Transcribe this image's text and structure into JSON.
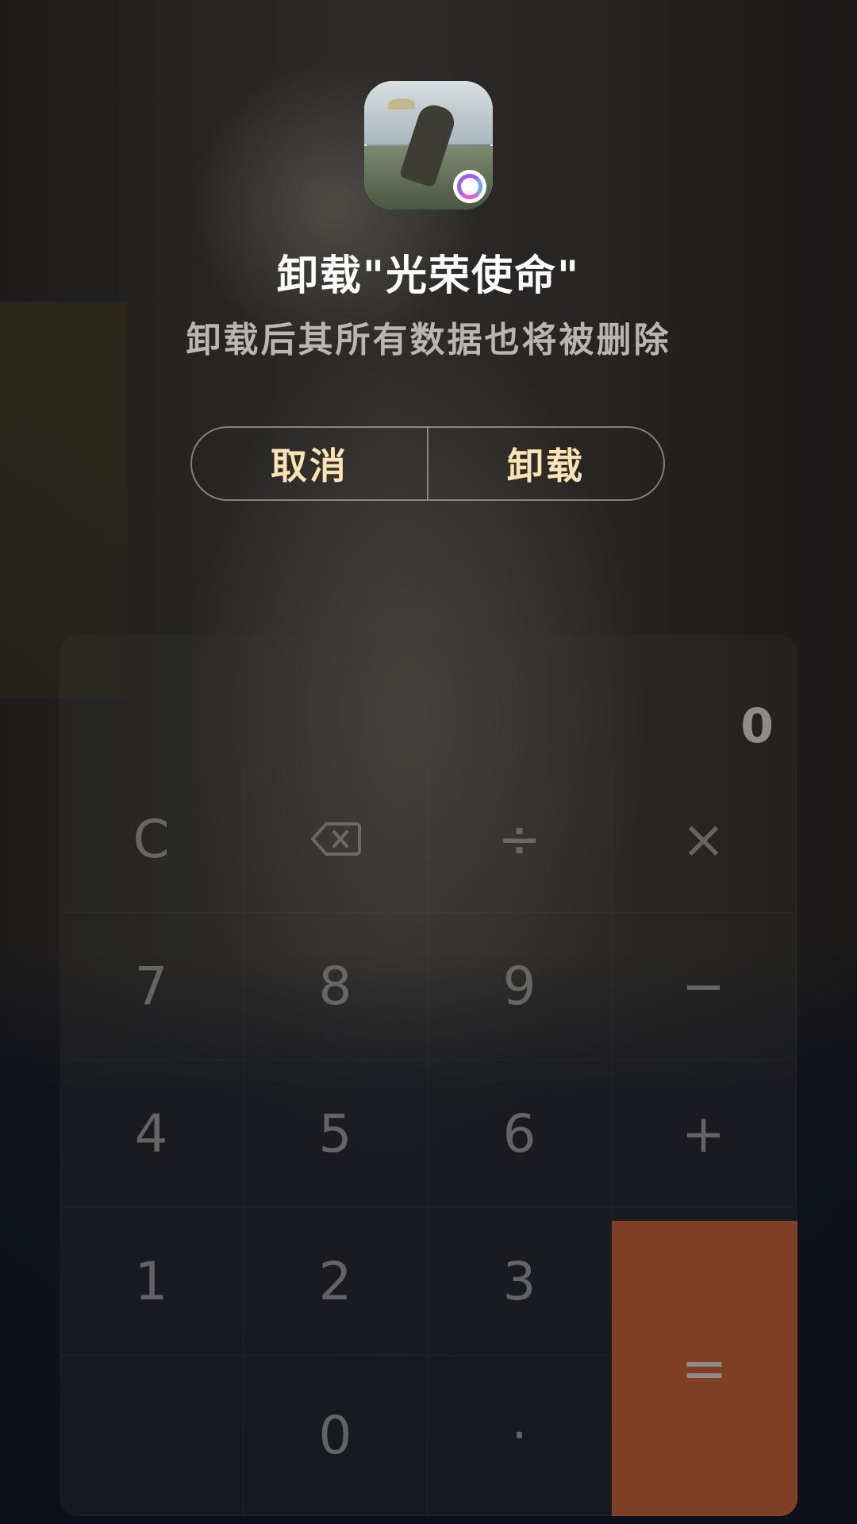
{
  "dialog": {
    "title": "卸载\"光荣使命\"",
    "subtitle": "卸载后其所有数据也将被删除",
    "cancel_label": "取消",
    "uninstall_label": "卸载",
    "accent_color": "#fbe3b4"
  },
  "calculator": {
    "display": "0",
    "keys": {
      "clear": "C",
      "divide": "÷",
      "multiply": "×",
      "seven": "7",
      "eight": "8",
      "nine": "9",
      "minus": "−",
      "four": "4",
      "five": "5",
      "six": "6",
      "plus": "+",
      "one": "1",
      "two": "2",
      "three": "3",
      "equals": "=",
      "zero": "0",
      "dot": "·"
    },
    "equals_color": "#964826"
  },
  "icons": [
    "backspace-icon",
    "app-icon"
  ]
}
